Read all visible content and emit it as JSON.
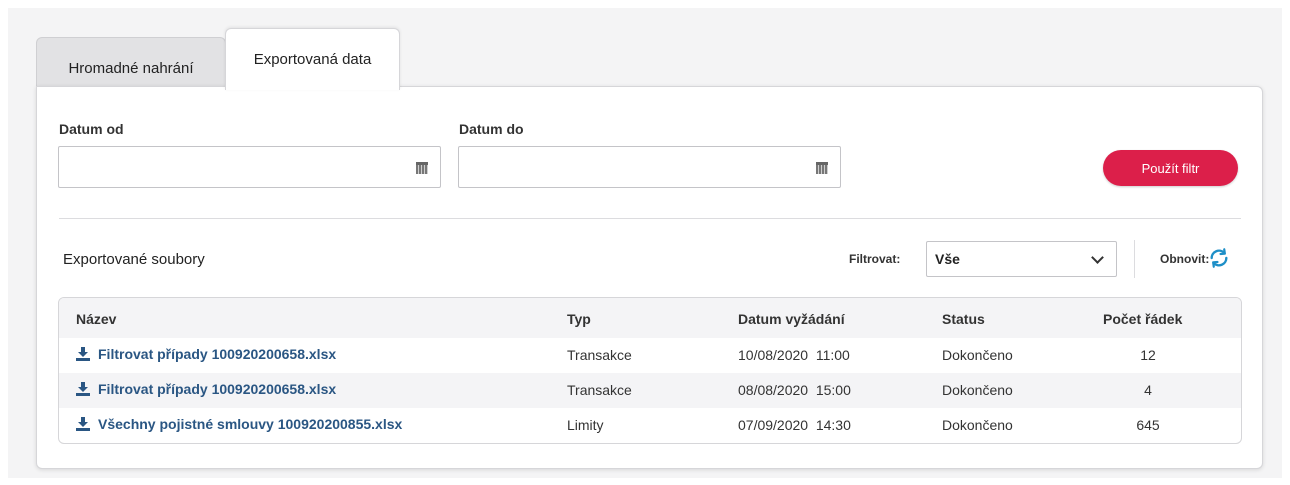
{
  "tabs": [
    {
      "label": "Hromadné nahrání",
      "active": false
    },
    {
      "label": "Exportovaná data",
      "active": true
    }
  ],
  "filters": {
    "date_from_label": "Datum od",
    "date_from_value": "",
    "date_to_label": "Datum do",
    "date_to_value": "",
    "apply_label": "Použít filtr"
  },
  "exports": {
    "title": "Exportované soubory",
    "filter_label": "Filtrovat:",
    "filter_value": "Vše",
    "refresh_label": "Obnovit:"
  },
  "table": {
    "columns": [
      "Název",
      "Typ",
      "Datum vyžádání",
      "Status",
      "Počet řádek"
    ],
    "rows": [
      {
        "name": "Filtrovat případy 100920200658.xlsx",
        "type": "Transakce",
        "date": "10/08/2020  11:00",
        "status": "Dokončeno",
        "count": "12"
      },
      {
        "name": "Filtrovat případy 100920200658.xlsx",
        "type": "Transakce",
        "date": "08/08/2020  15:00",
        "status": "Dokončeno",
        "count": "4"
      },
      {
        "name": "Všechny pojistné smlouvy 100920200855.xlsx",
        "type": "Limity",
        "date": "07/09/2020  14:30",
        "status": "Dokončeno",
        "count": "645"
      }
    ]
  },
  "icons": {
    "calendar": "calendar-icon",
    "chevron": "chevron-down-icon",
    "refresh": "refresh-icon",
    "download": "download-icon"
  },
  "colors": {
    "accent": "#dc1f4a",
    "link": "#2a5683",
    "refresh_icon": "#1e8fc7"
  }
}
